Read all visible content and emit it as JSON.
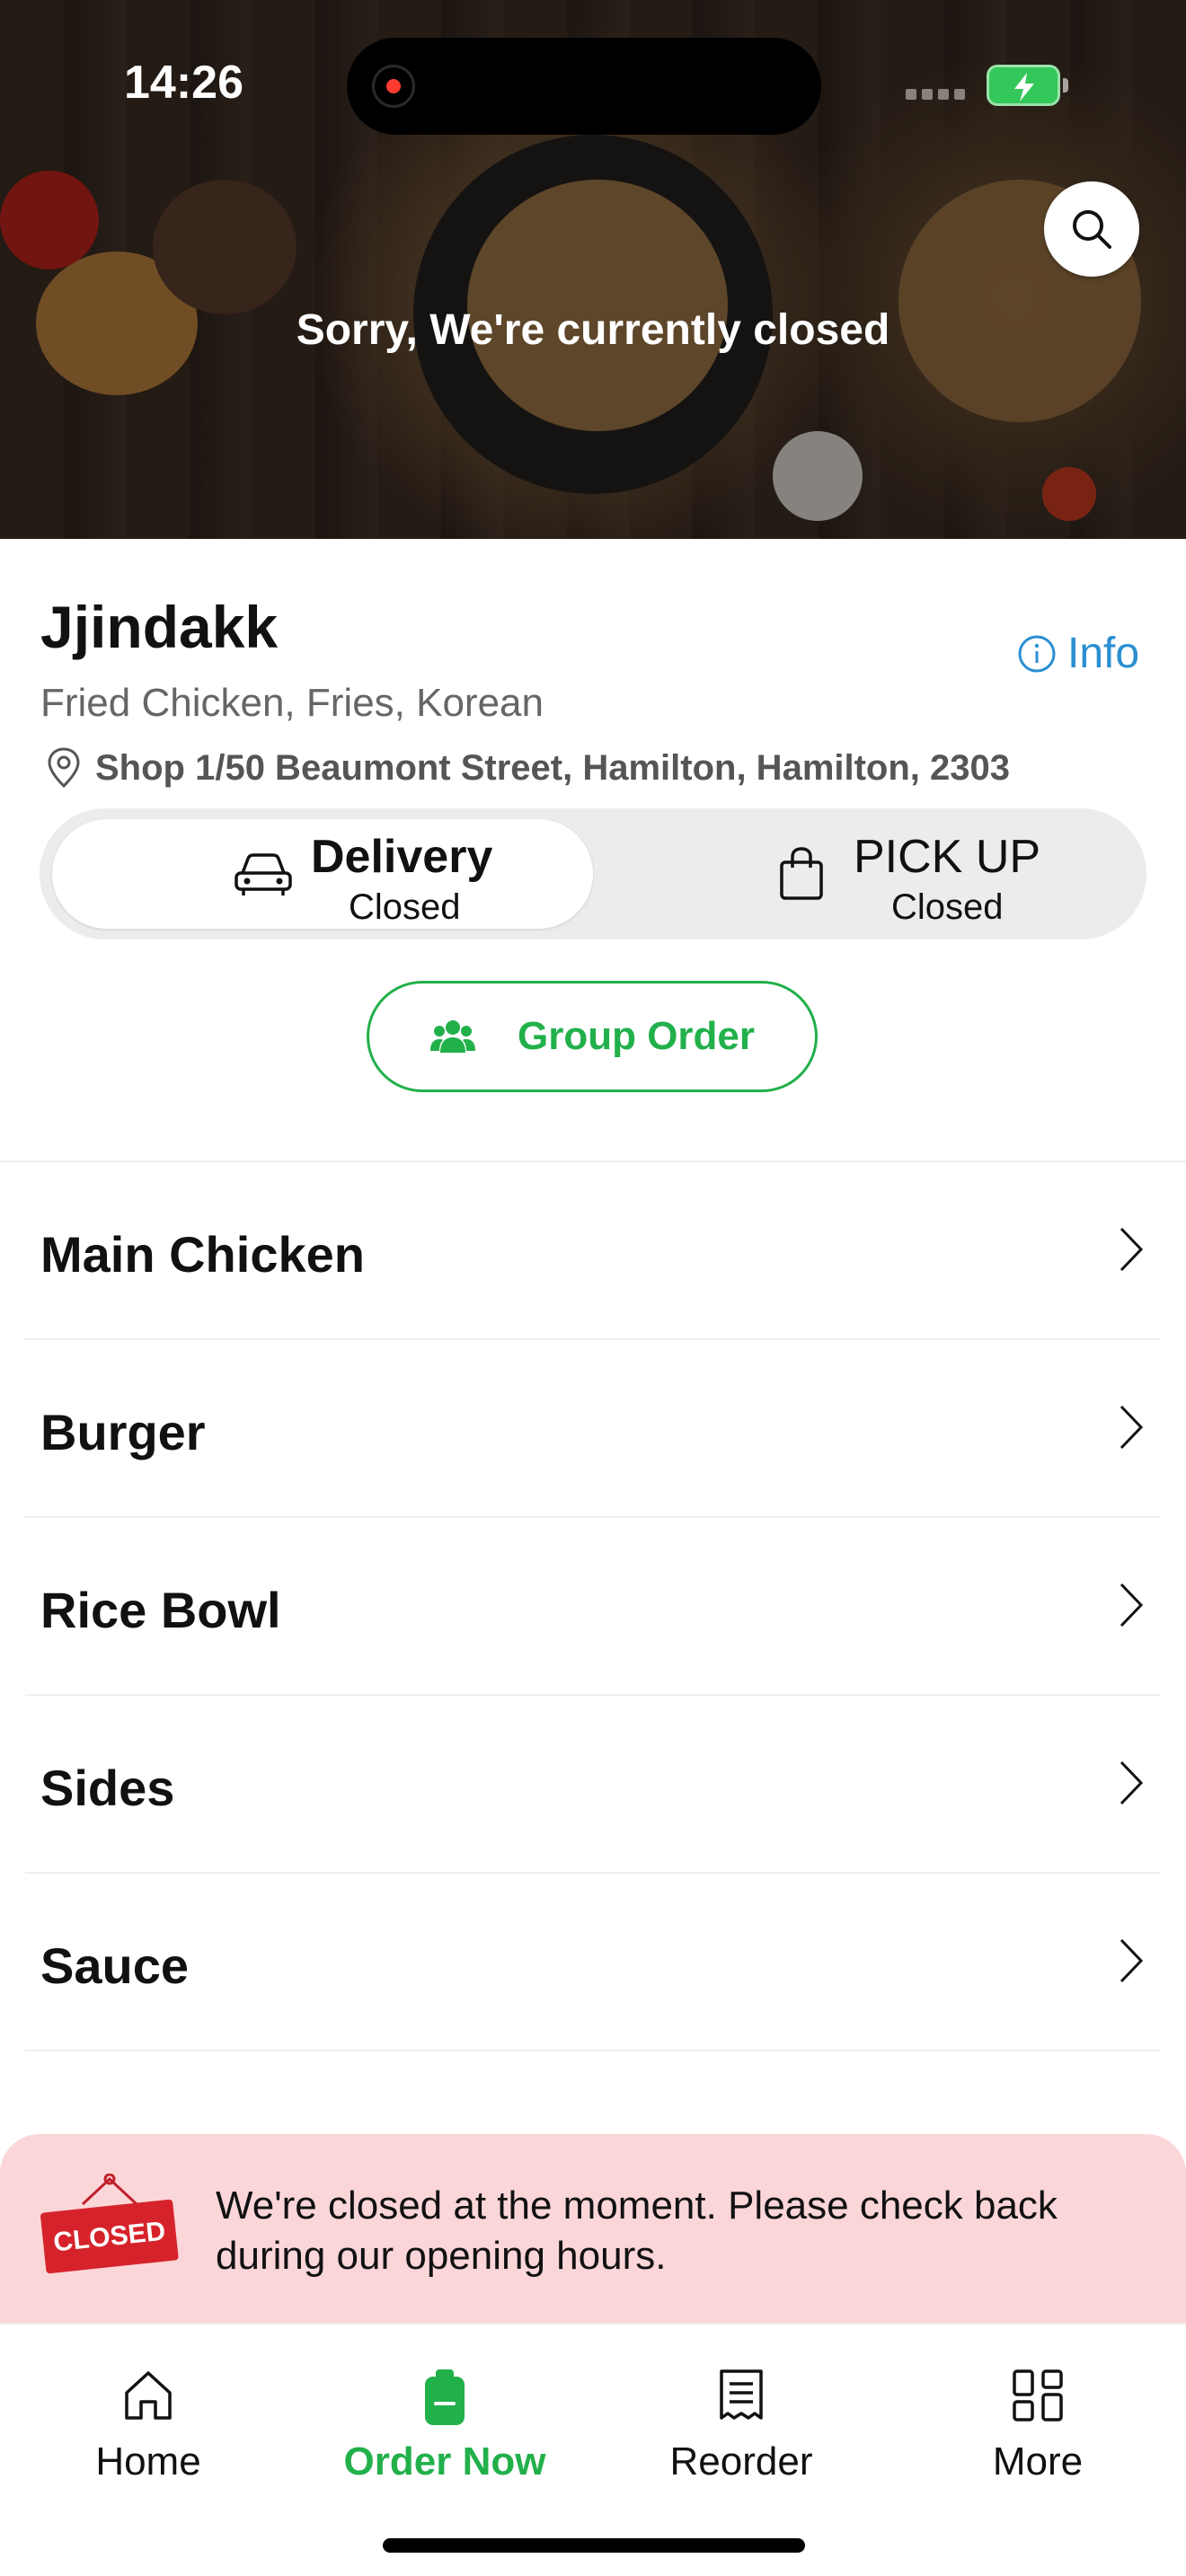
{
  "status_bar": {
    "time": "14:26"
  },
  "hero": {
    "closed_message": "Sorry, We're currently closed"
  },
  "store": {
    "name": "Jjindakk",
    "info_label": "Info",
    "cuisines": "Fried Chicken, Fries, Korean",
    "address": "Shop 1/50 Beaumont Street, Hamilton, Hamilton, 2303"
  },
  "order_modes": [
    {
      "label": "Delivery",
      "status": "Closed",
      "selected": true
    },
    {
      "label": "PICK UP",
      "status": "Closed",
      "selected": false
    }
  ],
  "group_order": {
    "label": "Group Order"
  },
  "menu_categories": [
    {
      "label": "Main Chicken"
    },
    {
      "label": "Burger"
    },
    {
      "label": "Rice Bowl"
    },
    {
      "label": "Sides"
    },
    {
      "label": "Sauce"
    }
  ],
  "closed_banner": {
    "sign_text": "CLOSED",
    "message": "We're closed at the moment. Please check back during our opening hours."
  },
  "tab_bar": [
    {
      "label": "Home",
      "icon": "home-icon",
      "active": false
    },
    {
      "label": "Order Now",
      "icon": "order-icon",
      "active": true
    },
    {
      "label": "Reorder",
      "icon": "receipt-icon",
      "active": false
    },
    {
      "label": "More",
      "icon": "grid-icon",
      "active": false
    }
  ],
  "colors": {
    "accent_green": "#22b04b",
    "info_blue": "#2a8fd0",
    "banner_pink": "#fbd6d9",
    "closed_red": "#d6232b"
  }
}
